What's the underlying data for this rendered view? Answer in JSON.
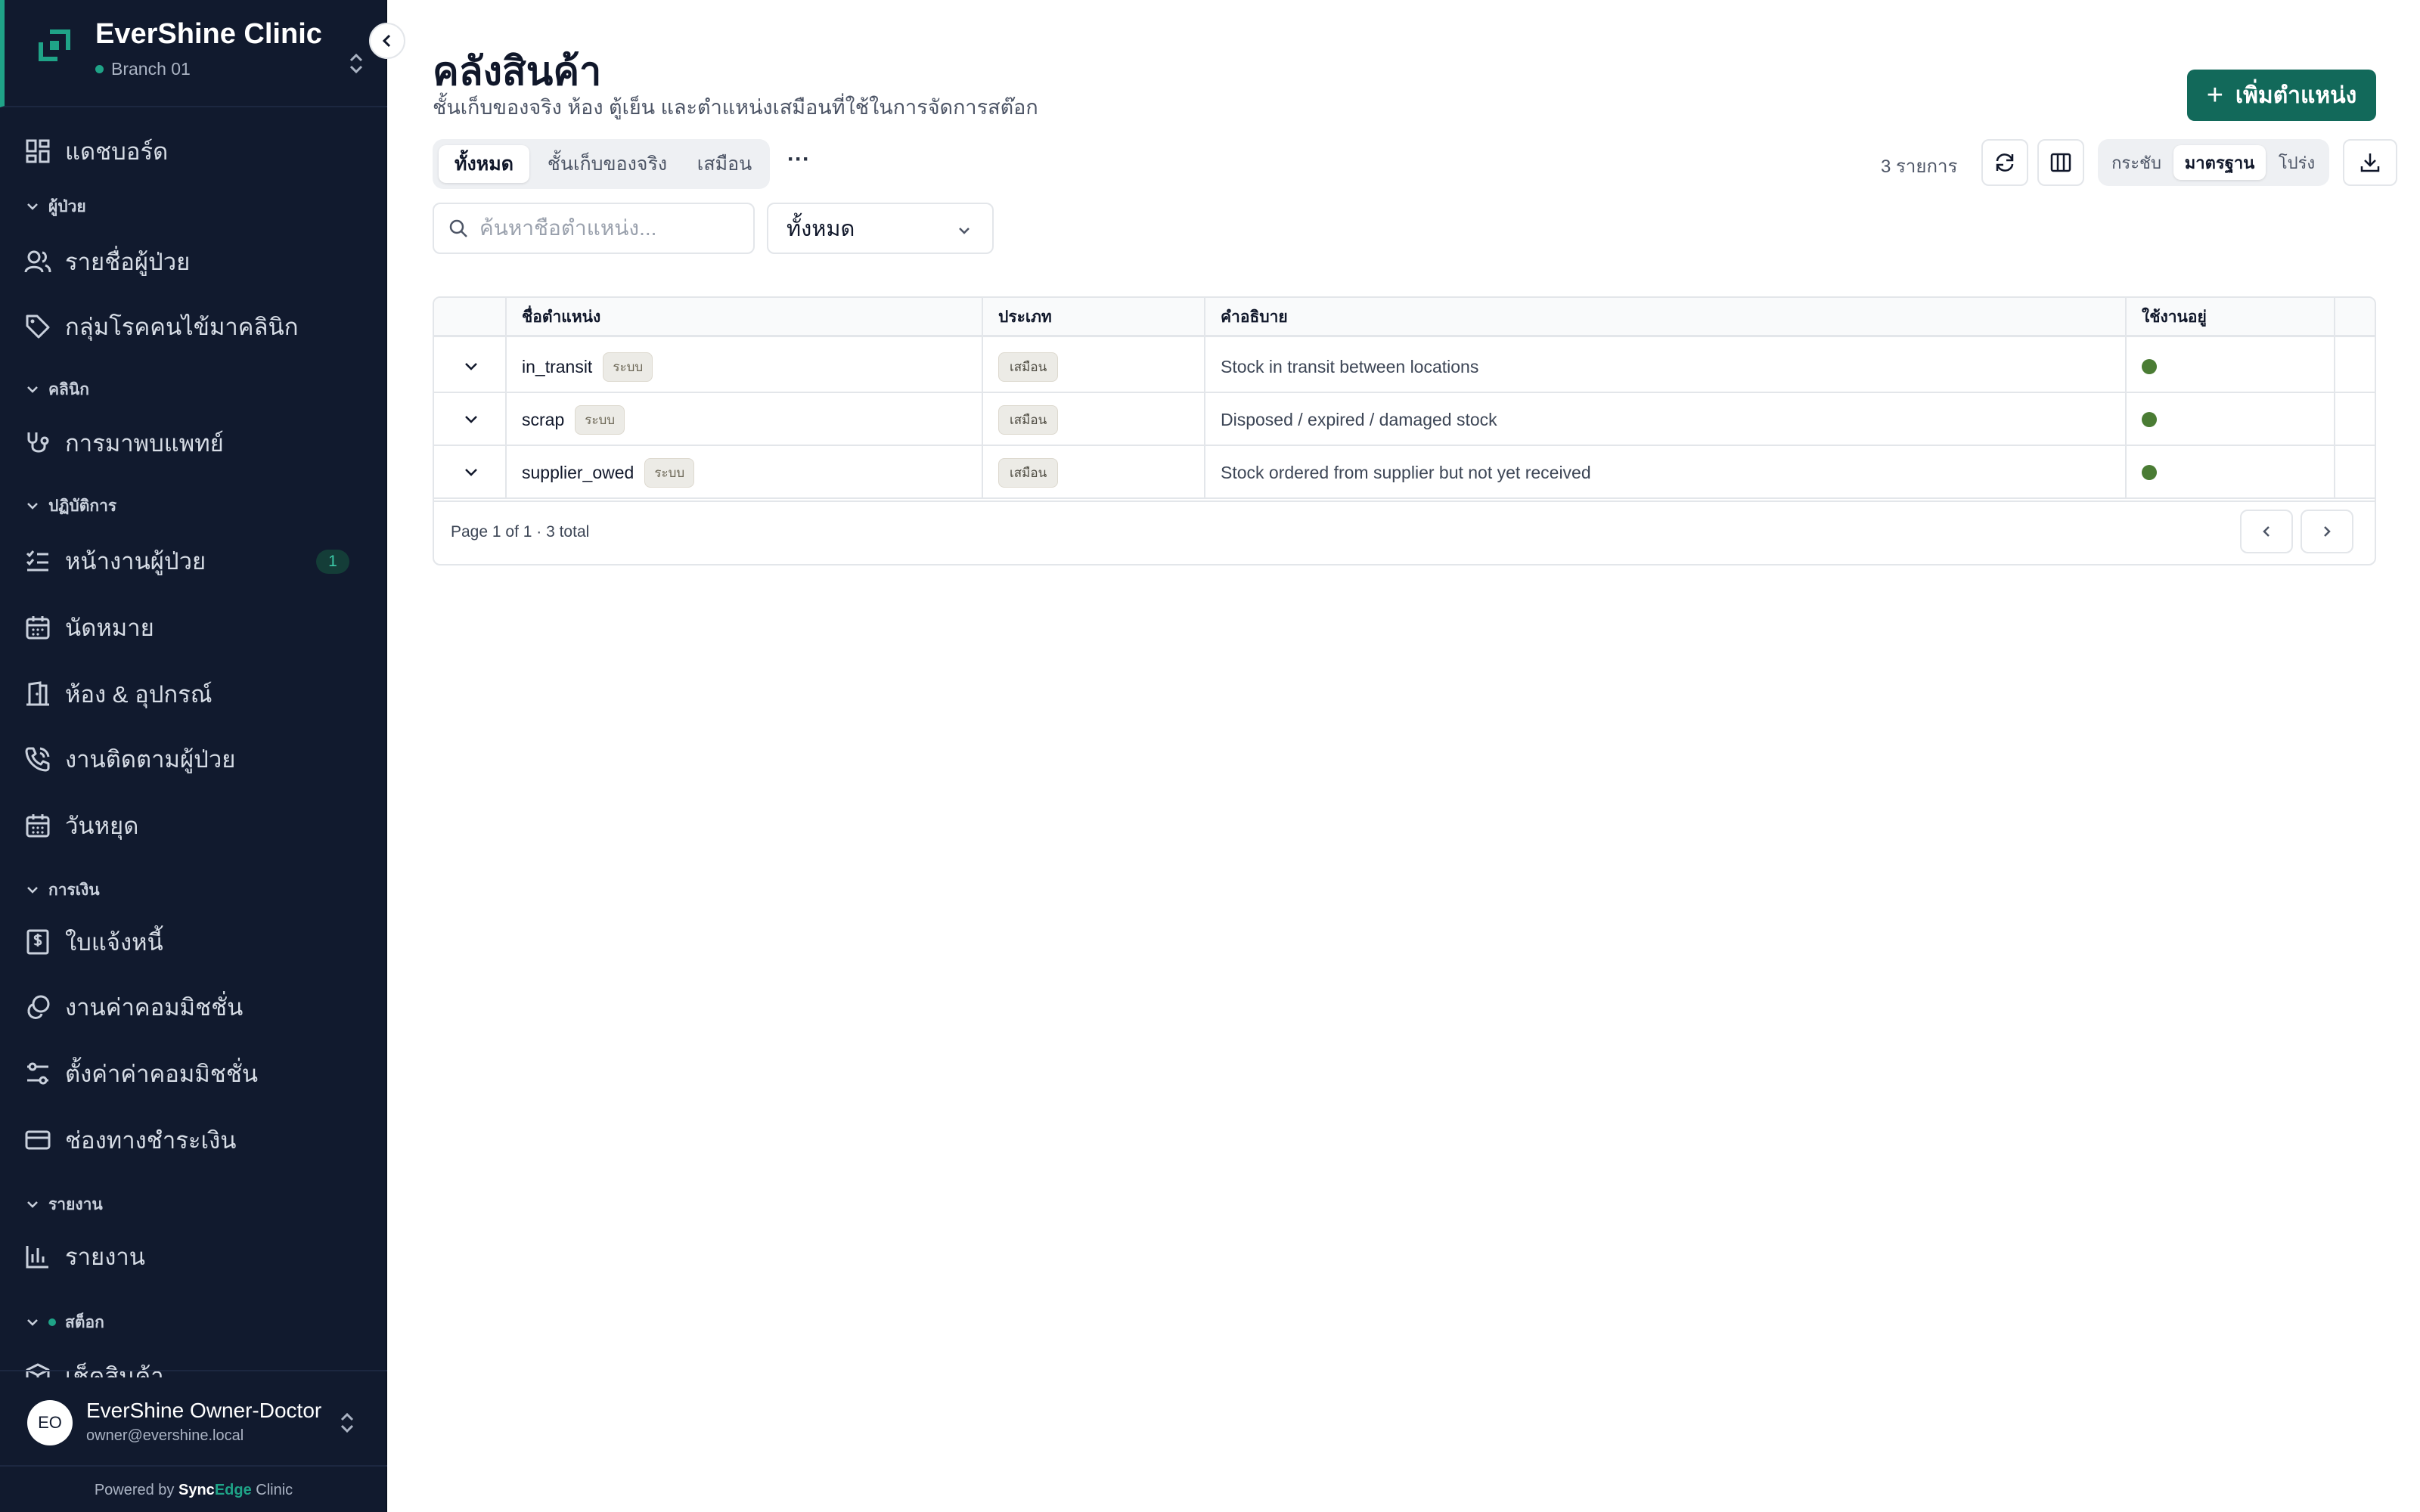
{
  "sidebar": {
    "brand_name": "EverShine Clinic",
    "branch": "Branch 01",
    "items": {
      "dashboard": "แดชบอร์ด",
      "sec_patients": "ผู้ป่วย",
      "patient_list": "รายชื่อผู้ป่วย",
      "disease_groups": "กลุ่มโรคคนไข้มาคลินิก",
      "sec_clinic": "คลินิก",
      "doctor_visits": "การมาพบแพทย์",
      "sec_operations": "ปฏิบัติการ",
      "patient_tasks": "หน้างานผู้ป่วย",
      "patient_tasks_badge": "1",
      "appointments": "นัดหมาย",
      "rooms_equipment": "ห้อง & อุปกรณ์",
      "patient_followup": "งานติดตามผู้ป่วย",
      "holidays": "วันหยุด",
      "sec_finance": "การเงิน",
      "invoices": "ใบแจ้งหนี้",
      "commission_tasks": "งานค่าคอมมิชชั่น",
      "commission_settings": "ตั้งค่าค่าคอมมิชชั่น",
      "payment_channels": "ช่องทางชำระเงิน",
      "sec_reports": "รายงาน",
      "reports": "รายงาน",
      "sec_stock": "สต็อก",
      "stock_partial": "เช็คสินค้า"
    },
    "user_initials": "EO",
    "user_name": "EverShine Owner-Doctor",
    "user_email": "owner@evershine.local",
    "powered_prefix": "Powered by",
    "powered_sync": "Sync",
    "powered_edge": "Edge",
    "powered_suffix": "Clinic"
  },
  "header": {
    "title": "คลังสินค้า",
    "subtitle": "ชั้นเก็บของจริง ห้อง ตู้เย็น และตำแหน่งเสมือนที่ใช้ในการจัดการสต๊อก",
    "add_button": "เพิ่มตำแหน่ง"
  },
  "toolbar": {
    "tabs": [
      "ทั้งหมด",
      "ชั้นเก็บของจริง",
      "เสมือน"
    ],
    "more": "···",
    "count": "3 รายการ",
    "density": [
      "กระชับ",
      "มาตรฐาน",
      "โปร่ง"
    ],
    "search_placeholder": "ค้นหาชื่อตำแหน่ง...",
    "filter_value": "ทั้งหมด"
  },
  "table": {
    "columns": [
      "ชื่อตำแหน่ง",
      "ประเภท",
      "คำอธิบาย",
      "ใช้งานอยู่"
    ],
    "rows": [
      {
        "name": "in_transit",
        "tag": "ระบบ",
        "type": "เสมือน",
        "description": "Stock in transit between locations",
        "active": true
      },
      {
        "name": "scrap",
        "tag": "ระบบ",
        "type": "เสมือน",
        "description": "Disposed / expired / damaged stock",
        "active": true
      },
      {
        "name": "supplier_owed",
        "tag": "ระบบ",
        "type": "เสมือน",
        "description": "Stock ordered from supplier but not yet received",
        "active": true
      }
    ],
    "footer": "Page 1 of 1 · 3 total"
  },
  "colors": {
    "sidebar_bg": "#111a2e",
    "accent": "#1fa387",
    "primary_button": "#12695a",
    "active_dot": "#4a7c34"
  }
}
